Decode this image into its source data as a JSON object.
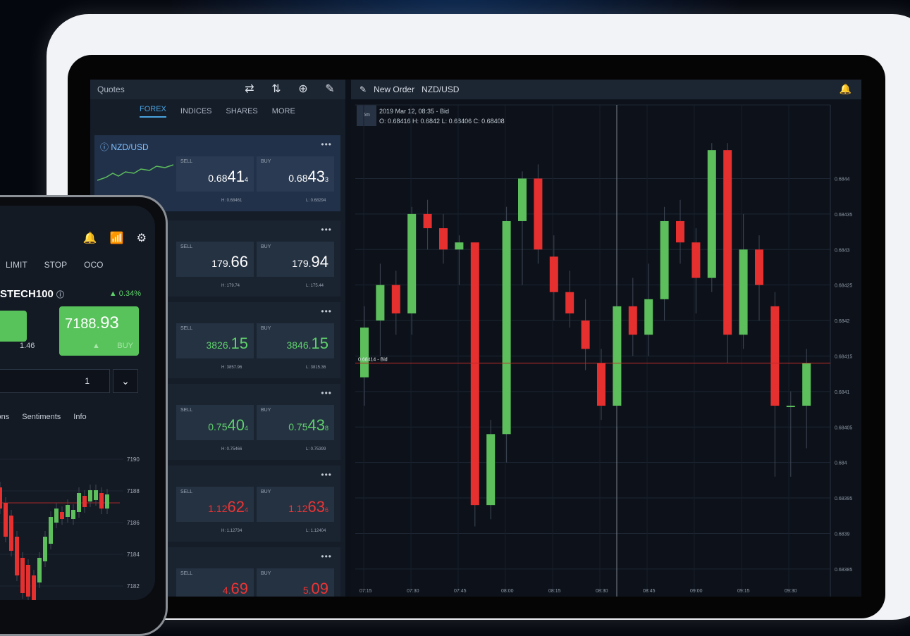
{
  "quotes": {
    "title": "Quotes",
    "icons": [
      "swap-icon",
      "sort-icon",
      "add-icon",
      "edit-icon"
    ],
    "tabs": [
      "FOREX",
      "INDICES",
      "SHARES",
      "MORE"
    ],
    "active_tab": "FOREX",
    "cards": [
      {
        "name": "NZD/USD",
        "sell_label": "SELL",
        "buy_label": "BUY",
        "sell_pre": "0.68",
        "sell_big": "41",
        "sell_sub": "4",
        "buy_pre": "0.68",
        "buy_big": "43",
        "buy_sub": "3",
        "high": "H: 0.68461",
        "low": "L: 0.68294",
        "color": "white"
      },
      {
        "name": "",
        "sell_label": "SELL",
        "buy_label": "BUY",
        "sell_pre": "179.",
        "sell_big": "66",
        "sell_sub": "",
        "buy_pre": "179.",
        "buy_big": "94",
        "buy_sub": "",
        "high": "H: 179.74",
        "low": "L: 175.44",
        "color": "white"
      },
      {
        "name": "",
        "sell_label": "SELL",
        "buy_label": "BUY",
        "sell_pre": "3826.",
        "sell_big": "15",
        "sell_sub": "",
        "buy_pre": "3846.",
        "buy_big": "15",
        "buy_sub": "",
        "high": "H: 3857.96",
        "low": "L: 3815.36",
        "color": "green"
      },
      {
        "name": "",
        "sell_label": "SELL",
        "buy_label": "BUY",
        "sell_pre": "0.75",
        "sell_big": "40",
        "sell_sub": "4",
        "buy_pre": "0.75",
        "buy_big": "43",
        "buy_sub": "8",
        "high": "H: 0.75466",
        "low": "L: 0.75399",
        "color": "green"
      },
      {
        "name": "",
        "sell_label": "SELL",
        "buy_label": "BUY",
        "sell_pre": "1.12",
        "sell_big": "62",
        "sell_sub": "4",
        "buy_pre": "1.12",
        "buy_big": "63",
        "buy_sub": "6",
        "high": "H: 1.12734",
        "low": "L: 1.12404",
        "color": "red"
      },
      {
        "name": "",
        "sell_label": "SELL",
        "buy_label": "BUY",
        "sell_pre": "4.",
        "sell_big": "69",
        "sell_sub": "",
        "buy_pre": "5.",
        "buy_big": "09",
        "buy_sub": "",
        "high": "",
        "low": "",
        "color": "red"
      }
    ]
  },
  "chart_panel": {
    "new_order": "New Order",
    "symbol": "NZD/USD",
    "timeframe": "5m",
    "bar_info": "2019 Mar 12, 08:35 - Bid",
    "ohlc": "O: 0.68416 H: 0.6842 L: 0.68406 C: 0.68408",
    "price_line_label": "0.68414 - Bid"
  },
  "chart_data": {
    "type": "candlestick",
    "price_ticks": [
      "0.6844",
      "0.68435",
      "0.6843",
      "0.68425",
      "0.6842",
      "0.68415",
      "0.6841",
      "0.68405",
      "0.684",
      "0.68395",
      "0.6839",
      "0.68385"
    ],
    "time_ticks": [
      "07:15",
      "07:30",
      "07:45",
      "08:00",
      "08:15",
      "08:30",
      "08:45",
      "09:00",
      "09:15",
      "09:30"
    ],
    "current_price": 0.68414,
    "candles": [
      {
        "o": 0.68412,
        "c": 0.68419,
        "h": 0.68422,
        "l": 0.68408
      },
      {
        "o": 0.6842,
        "c": 0.68425,
        "h": 0.68428,
        "l": 0.68415
      },
      {
        "o": 0.68425,
        "c": 0.68421,
        "h": 0.68427,
        "l": 0.68418
      },
      {
        "o": 0.68421,
        "c": 0.68435,
        "h": 0.68436,
        "l": 0.68418
      },
      {
        "o": 0.68435,
        "c": 0.68433,
        "h": 0.68437,
        "l": 0.6843
      },
      {
        "o": 0.68433,
        "c": 0.6843,
        "h": 0.68435,
        "l": 0.68428
      },
      {
        "o": 0.6843,
        "c": 0.68431,
        "h": 0.68432,
        "l": 0.68425
      },
      {
        "o": 0.68431,
        "c": 0.68394,
        "h": 0.68431,
        "l": 0.68391
      },
      {
        "o": 0.68394,
        "c": 0.68404,
        "h": 0.68406,
        "l": 0.68392
      },
      {
        "o": 0.68404,
        "c": 0.68434,
        "h": 0.68436,
        "l": 0.684
      },
      {
        "o": 0.68434,
        "c": 0.6844,
        "h": 0.68441,
        "l": 0.68425
      },
      {
        "o": 0.6844,
        "c": 0.6843,
        "h": 0.68442,
        "l": 0.68428
      },
      {
        "o": 0.68429,
        "c": 0.68424,
        "h": 0.68432,
        "l": 0.6842
      },
      {
        "o": 0.68424,
        "c": 0.68421,
        "h": 0.68427,
        "l": 0.68419
      },
      {
        "o": 0.6842,
        "c": 0.68416,
        "h": 0.68423,
        "l": 0.68413
      },
      {
        "o": 0.68414,
        "c": 0.68408,
        "h": 0.68416,
        "l": 0.68406
      },
      {
        "o": 0.68408,
        "c": 0.68422,
        "h": 0.68425,
        "l": 0.68405
      },
      {
        "o": 0.68422,
        "c": 0.68418,
        "h": 0.68426,
        "l": 0.68415
      },
      {
        "o": 0.68418,
        "c": 0.68423,
        "h": 0.68428,
        "l": 0.68415
      },
      {
        "o": 0.68423,
        "c": 0.68434,
        "h": 0.68436,
        "l": 0.6842
      },
      {
        "o": 0.68434,
        "c": 0.68431,
        "h": 0.68437,
        "l": 0.68428
      },
      {
        "o": 0.68431,
        "c": 0.68426,
        "h": 0.68433,
        "l": 0.68421
      },
      {
        "o": 0.68426,
        "c": 0.68444,
        "h": 0.68445,
        "l": 0.68424
      },
      {
        "o": 0.68444,
        "c": 0.68418,
        "h": 0.68445,
        "l": 0.68414
      },
      {
        "o": 0.68418,
        "c": 0.6843,
        "h": 0.68435,
        "l": 0.68416
      },
      {
        "o": 0.6843,
        "c": 0.68425,
        "h": 0.68432,
        "l": 0.6842
      },
      {
        "o": 0.68422,
        "c": 0.68408,
        "h": 0.68424,
        "l": 0.68398
      },
      {
        "o": 0.68408,
        "c": 0.68408,
        "h": 0.6841,
        "l": 0.68398
      },
      {
        "o": 0.68408,
        "c": 0.68414,
        "h": 0.68416,
        "l": 0.68402
      }
    ]
  },
  "phone": {
    "icons": [
      "bell-icon",
      "signal-icon",
      "settings-icon"
    ],
    "order_tabs": [
      "LIMIT",
      "STOP",
      "OCO"
    ],
    "symbol": "STECH100",
    "change": "▲ 0.34%",
    "buy_price_pre": "7188.",
    "buy_price_big": "93",
    "buy_label": "BUY",
    "spread": "1.46",
    "quantity": "1",
    "sub_tabs": [
      "tions",
      "Sentiments",
      "Info"
    ],
    "price_ticks": [
      "7190",
      "7188",
      "7186",
      "7184",
      "7182"
    ]
  },
  "colors": {
    "up": "#5cbf5c",
    "down": "#e62f2f",
    "accent": "#4aa3e0"
  }
}
